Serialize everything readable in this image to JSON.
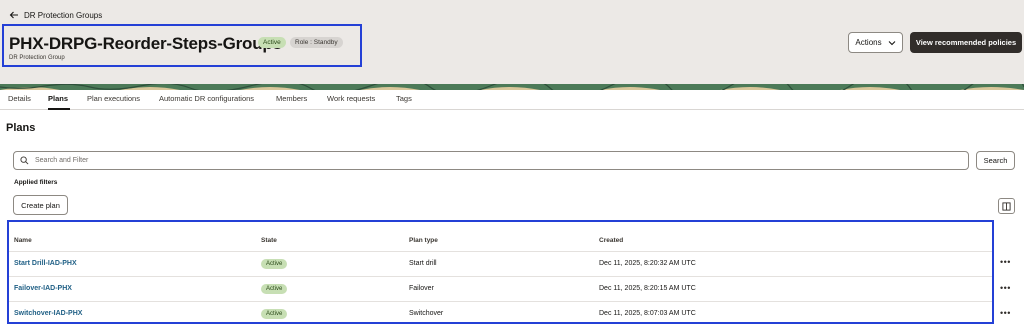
{
  "header": {
    "back_label": "DR Protection Groups",
    "title": "PHX-DRPG-Reorder-Steps-Groups",
    "status_badge": "Active",
    "role_badge": "Role : Standby",
    "subtitle": "DR Protection Group",
    "actions_label": "Actions",
    "recommend_label": "View recommended policies"
  },
  "tabs": [
    {
      "label": "Details"
    },
    {
      "label": "Plans"
    },
    {
      "label": "Plan executions"
    },
    {
      "label": "Automatic DR configurations"
    },
    {
      "label": "Members"
    },
    {
      "label": "Work requests"
    },
    {
      "label": "Tags"
    }
  ],
  "active_tab": "Plans",
  "section": {
    "title": "Plans",
    "search_placeholder": "Search and Filter",
    "search_button": "Search",
    "applied_filters": "Applied filters",
    "create_button": "Create plan"
  },
  "table": {
    "columns": [
      "Name",
      "State",
      "Plan type",
      "Created"
    ],
    "rows": [
      {
        "name": "Start Drill-IAD-PHX",
        "state": "Active",
        "plan_type": "Start drill",
        "created": "Dec 11, 2025, 8:20:32 AM UTC"
      },
      {
        "name": "Failover-IAD-PHX",
        "state": "Active",
        "plan_type": "Failover",
        "created": "Dec 11, 2025, 8:20:15 AM UTC"
      },
      {
        "name": "Switchover-IAD-PHX",
        "state": "Active",
        "plan_type": "Switchover",
        "created": "Dec 11, 2025, 8:07:03 AM UTC"
      }
    ]
  },
  "colors": {
    "accent_dark": "#312d2a",
    "link": "#1f5f85",
    "badge_active_bg": "#c7dfb4",
    "highlight_border": "#2440d6",
    "header_bg": "#ece9e6"
  },
  "icons": {
    "back": "arrow-left-icon",
    "actions": "chevron-down-icon",
    "search": "search-icon",
    "columns": "columns-icon",
    "row_menu": "more-horizontal-icon"
  }
}
